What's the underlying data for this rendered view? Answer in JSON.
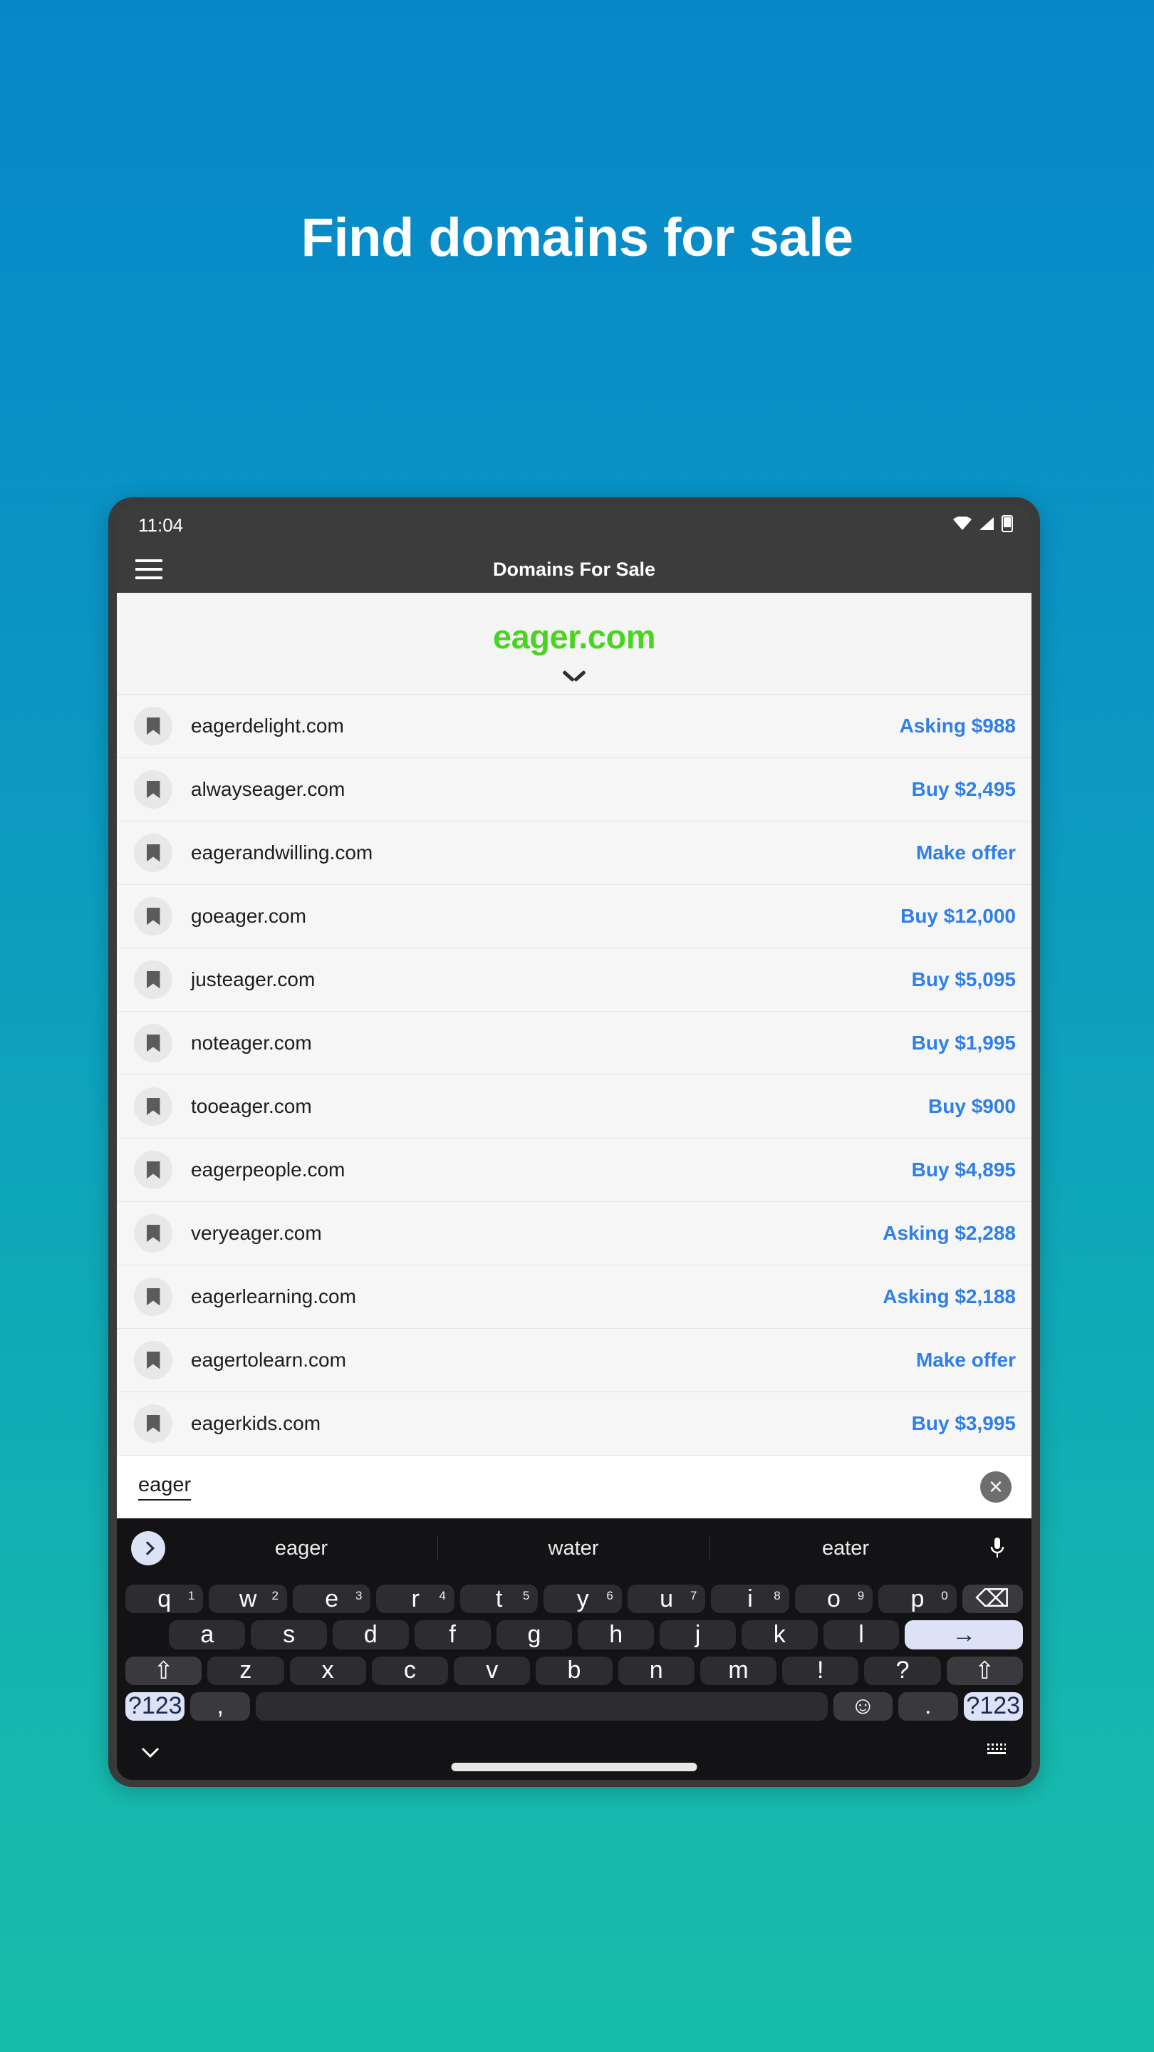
{
  "hero": {
    "headline": "Find domains for sale"
  },
  "phone": {
    "status": {
      "time": "11:04",
      "icons": [
        "wifi-icon",
        "signal-icon",
        "battery-icon"
      ]
    },
    "appbar": {
      "title": "Domains For Sale",
      "menu_icon": "hamburger-icon"
    },
    "domain_header": {
      "name": "eager.com",
      "expand_icon": "chevron-down-icon"
    },
    "listings": [
      {
        "domain": "eagerdelight.com",
        "price": "Asking $988"
      },
      {
        "domain": "alwayseager.com",
        "price": "Buy $2,495"
      },
      {
        "domain": "eagerandwilling.com",
        "price": "Make offer"
      },
      {
        "domain": "goeager.com",
        "price": "Buy $12,000"
      },
      {
        "domain": "justeager.com",
        "price": "Buy $5,095"
      },
      {
        "domain": "noteager.com",
        "price": "Buy $1,995"
      },
      {
        "domain": "tooeager.com",
        "price": "Buy $900"
      },
      {
        "domain": "eagerpeople.com",
        "price": "Buy $4,895"
      },
      {
        "domain": "veryeager.com",
        "price": "Asking $2,288"
      },
      {
        "domain": "eagerlearning.com",
        "price": "Asking $2,188"
      },
      {
        "domain": "eagertolearn.com",
        "price": "Make offer"
      },
      {
        "domain": "eagerkids.com",
        "price": "Buy $3,995"
      }
    ],
    "search": {
      "value": "eager",
      "clear_label": "✕"
    },
    "keyboard": {
      "suggestions": [
        "eager",
        "water",
        "eater"
      ],
      "expand_icon": "chevron-right-icon",
      "mic_icon": "microphone-icon",
      "row1": [
        {
          "k": "q",
          "n": "1"
        },
        {
          "k": "w",
          "n": "2"
        },
        {
          "k": "e",
          "n": "3"
        },
        {
          "k": "r",
          "n": "4"
        },
        {
          "k": "t",
          "n": "5"
        },
        {
          "k": "y",
          "n": "6"
        },
        {
          "k": "u",
          "n": "7"
        },
        {
          "k": "i",
          "n": "8"
        },
        {
          "k": "o",
          "n": "9"
        },
        {
          "k": "p",
          "n": "0"
        }
      ],
      "backspace_label": "⌫",
      "row2": [
        "a",
        "s",
        "d",
        "f",
        "g",
        "h",
        "j",
        "k",
        "l"
      ],
      "enter_label": "→",
      "row3": [
        "z",
        "x",
        "c",
        "v",
        "b",
        "n",
        "m",
        "!",
        "?"
      ],
      "shift_label": "⇧",
      "row4": {
        "symbols_left": "?123",
        "comma": ",",
        "space": "",
        "emoji": "☺",
        "period": ".",
        "symbols_right": "?123"
      }
    },
    "navbar": {
      "back_icon": "chevron-down-icon",
      "home_pill": "home-indicator",
      "keyboard_icon": "keyboard-icon"
    }
  }
}
